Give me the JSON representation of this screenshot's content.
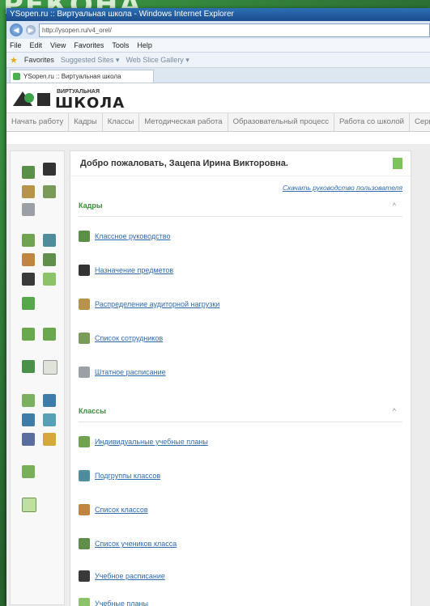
{
  "background_text": "РЕКОНА",
  "window": {
    "title": "YSopen.ru :: Виртуальная школа - Windows Internet Explorer",
    "url": "http://ysopen.ru/v4_orel/"
  },
  "menu": [
    "File",
    "Edit",
    "View",
    "Favorites",
    "Tools",
    "Help"
  ],
  "favorites": {
    "label": "Favorites",
    "suggested": "Suggested Sites ▾",
    "gallery": "Web Slice Gallery ▾"
  },
  "tab": {
    "label": "YSopen.ru :: Виртуальная школа"
  },
  "logo": {
    "small": "ВИРТУАЛЬНАЯ",
    "big": "ШКОЛА"
  },
  "site_nav": [
    "Начать работу",
    "Кадры",
    "Классы",
    "Методическая работа",
    "Образовательный процесс",
    "Работа со школой",
    "Сервис"
  ],
  "welcome": "Добро пожаловать, Зацепа Ирина Викторовна.",
  "guide_link": "Скачать руководство пользователя",
  "sections": [
    {
      "title": "Кадры",
      "chevron": "^",
      "items": [
        "Классное руководство",
        "Назначение предметов",
        "Распределение аудиторной нагрузки",
        "Список сотрудников",
        "Штатное расписание"
      ]
    },
    {
      "title": "Классы",
      "chevron": "^",
      "items": [
        "Индивидуальные учебные планы",
        "Подгруппы классов",
        "Список классов",
        "Список учеников класса",
        "Учебное расписание",
        "Учебные планы"
      ]
    }
  ]
}
